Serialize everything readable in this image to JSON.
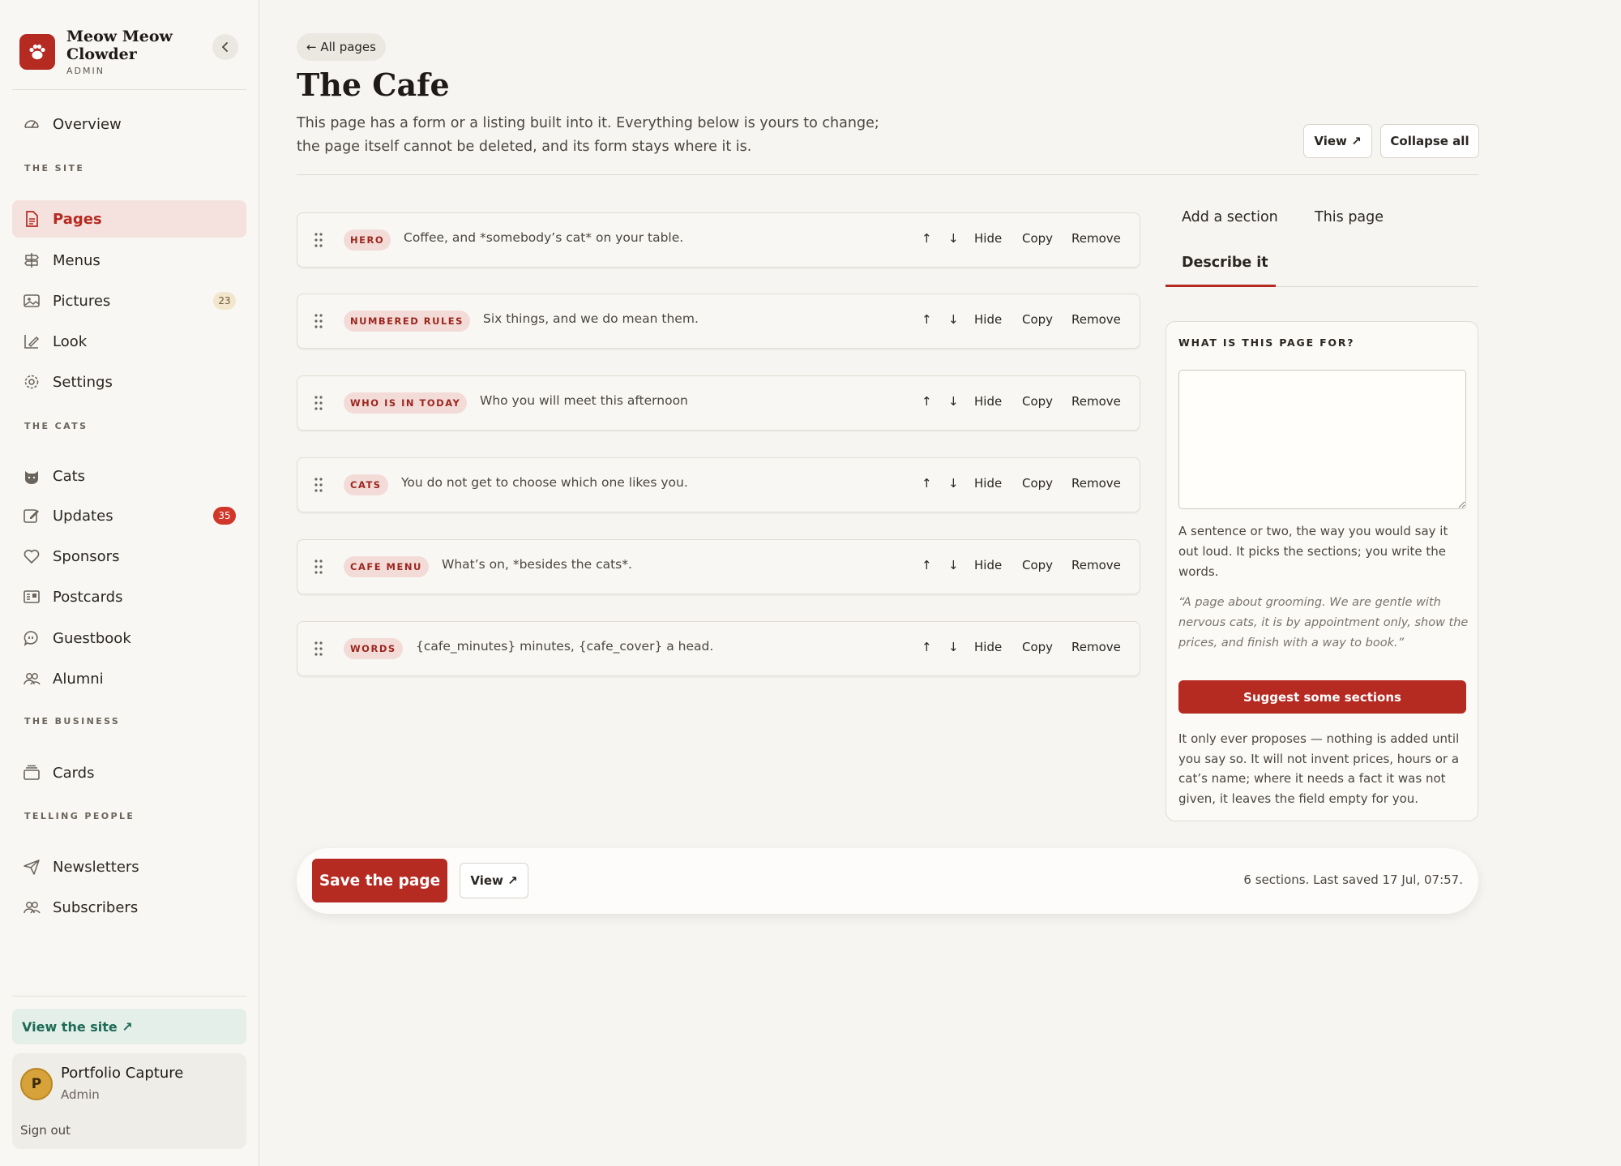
{
  "brand": {
    "name": "Meow Meow Clowder",
    "role": "ADMIN"
  },
  "nav": {
    "overview": "Overview",
    "section_site": "THE SITE",
    "pages": "Pages",
    "menus": "Menus",
    "pictures": "Pictures",
    "pictures_count": "23",
    "look": "Look",
    "settings": "Settings",
    "section_cats": "THE CATS",
    "cats": "Cats",
    "updates": "Updates",
    "updates_count": "35",
    "sponsors": "Sponsors",
    "postcards": "Postcards",
    "guestbook": "Guestbook",
    "alumni": "Alumni",
    "section_business": "THE BUSINESS",
    "cards": "Cards",
    "section_telling": "TELLING PEOPLE",
    "newsletters": "Newsletters",
    "subscribers": "Subscribers",
    "view_site": "View the site ↗"
  },
  "user": {
    "initial": "P",
    "name": "Portfolio Capture",
    "role": "Admin",
    "sign_out": "Sign out"
  },
  "header": {
    "back": "← All pages",
    "title": "The Cafe",
    "description": "This page has a form or a listing built into it. Everything below is yours to change; the page itself cannot be deleted, and its form stays where it is.",
    "view": "View ↗",
    "collapse": "Collapse all"
  },
  "row_actions": {
    "up": "↑",
    "down": "↓",
    "hide": "Hide",
    "copy": "Copy",
    "remove": "Remove"
  },
  "sections": [
    {
      "tag": "HERO",
      "text": "Coffee, and *somebody’s cat* on your table."
    },
    {
      "tag": "NUMBERED RULES",
      "text": "Six things, and we do mean them."
    },
    {
      "tag": "WHO IS IN TODAY",
      "text": "Who you will meet this afternoon"
    },
    {
      "tag": "CATS",
      "text": "You do not get to choose which one likes you."
    },
    {
      "tag": "CAFE MENU",
      "text": "What’s on, *besides the cats*."
    },
    {
      "tag": "WORDS",
      "text": "{cafe_minutes} minutes, {cafe_cover} a head."
    }
  ],
  "tabs": {
    "add": "Add a section",
    "this_page": "This page",
    "describe": "Describe it"
  },
  "panel": {
    "label": "WHAT IS THIS PAGE FOR?",
    "textarea_value": "",
    "help": "A sentence or two, the way you would say it out loud. It picks the sections; you write the words.",
    "example": "“A page about grooming. We are gentle with nervous cats, it is by appointment only, show the prices, and finish with a way to book.”",
    "suggest": "Suggest some sections",
    "note": "It only ever proposes — nothing is added until you say so. It will not invent prices, hours or a cat’s name; where it needs a fact it was not given, it leaves the field empty for you."
  },
  "save_bar": {
    "save": "Save the page",
    "view": "View ↗",
    "status": "6 sections. Last saved 17 Jul, 07:57."
  },
  "colors": {
    "accent": "#b52a21",
    "badge_red": "#d0362a",
    "site_link": "#1d6a55"
  }
}
